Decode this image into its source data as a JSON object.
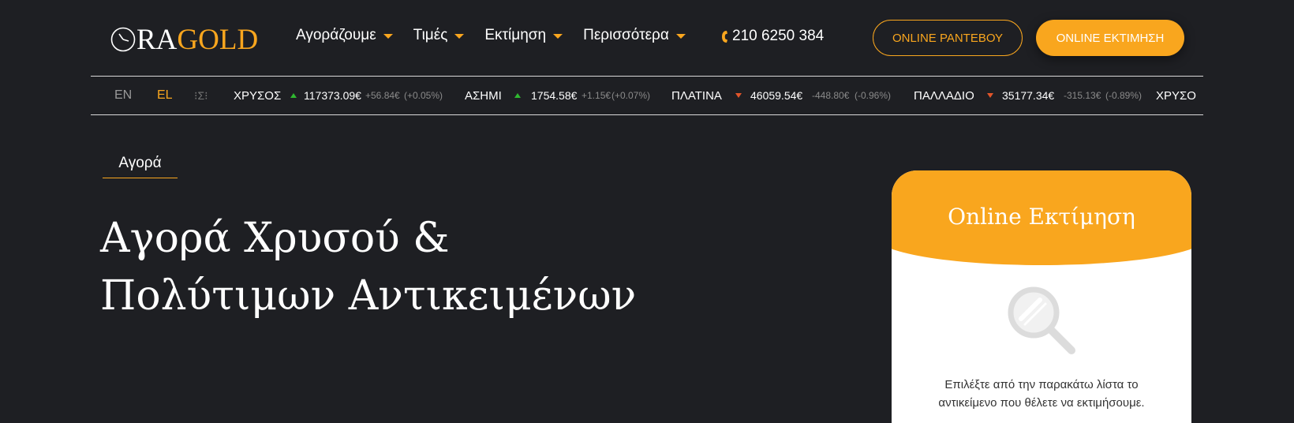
{
  "header": {
    "logo": {
      "part1": "RA",
      "part2": "GOLD",
      "icon": "clock-icon"
    },
    "nav": [
      {
        "label": "Αγοράζουμε",
        "icon": "chevron-down-icon"
      },
      {
        "label": "Τιμές",
        "icon": "chevron-down-icon"
      },
      {
        "label": "Εκτίμηση",
        "icon": "chevron-down-icon"
      },
      {
        "label": "Περισσότερα",
        "icon": "chevron-down-icon"
      }
    ],
    "phone": "210 6250 384",
    "buttons": {
      "appointment": "ONLINE ΡΑΝΤΕΒΟΥ",
      "estimate": "ONLINE ΕΚΤΙΜΗΣΗ"
    }
  },
  "ticker": {
    "languages": [
      "EN",
      "EL"
    ],
    "active_language": "EL",
    "items": [
      {
        "name": "ΧΡΥΣΟΣ",
        "direction": "up",
        "price": "117373.09€",
        "change": "+56.84€",
        "percent": "(+0.05%)"
      },
      {
        "name": "ΑΣΗΜΙ",
        "direction": "up",
        "price": "1754.58€",
        "change": "+1.15€",
        "percent": "(+0.07%)"
      },
      {
        "name": "ΠΛΑΤΙΝΑ",
        "direction": "down",
        "price": "46059.54€",
        "change": "-448.80€",
        "percent": "(-0.96%)"
      },
      {
        "name": "ΠΑΛΛΑΔΙΟ",
        "direction": "down",
        "price": "35177.34€",
        "change": "-315.13€",
        "percent": "(-0.89%)"
      },
      {
        "name": "ΧΡΥΣΟ"
      }
    ]
  },
  "main": {
    "breadcrumb": "Αγορά",
    "title_line1": "Αγορά Χρυσού &",
    "title_line2": "Πολύτιμων Αντικειμένων"
  },
  "card": {
    "title": "Online Εκτίμηση",
    "icon": "magnifier-icon",
    "text_line1": "Επιλέξτε από την παρακάτω λίστα το",
    "text_line2": "αντικείμενο που θέλετε να εκτιμήσουμε."
  },
  "colors": {
    "accent": "#f9a61e",
    "background": "#1e1f23",
    "up": "#2fb830",
    "down": "#e2552a"
  }
}
